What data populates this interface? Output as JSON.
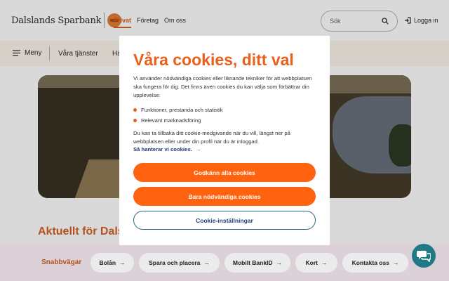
{
  "header": {
    "brand": "Dalslands Sparbank",
    "nav": [
      "Privat",
      "Företag",
      "Om oss"
    ],
    "search_placeholder": "Sök",
    "login_label": "Logga in"
  },
  "subnav": {
    "menu_label": "Meny",
    "links": [
      "Våra tjänster",
      "Hä"
    ]
  },
  "news": {
    "title": "Aktuellt för Dals"
  },
  "quick_links": {
    "label": "Snabbvägar",
    "items": [
      "Bolån",
      "Spara och placera",
      "Mobilt BankID",
      "Kort",
      "Kontakta oss"
    ]
  },
  "cookie_modal": {
    "title": "Våra cookies, ditt val",
    "intro": "Vi använder nödvändiga cookies eller liknande tekniker för att webbplatsen ska fungera för dig. Det finns även cookies du kan välja som förbättrar din upplevelse:",
    "bullets": [
      "Funktioner, prestanda och statistik",
      "Relevant marknadsföring"
    ],
    "withdraw_text": "Du kan ta tillbaka ditt cookie-medgivande när du vill, längst ner på webbplatsen eller under din profil när du är inloggad.",
    "manage_link": "Så hanterar vi cookies.",
    "accept_all_label": "Godkänn alla cookies",
    "necessary_only_label": "Bara nödvändiga cookies",
    "settings_label": "Cookie-inställningar"
  },
  "colors": {
    "brand_orange": "#ff6310",
    "title_orange": "#e8601c",
    "link_blue": "#1d3f7a",
    "chat_teal": "#1f7a86"
  }
}
